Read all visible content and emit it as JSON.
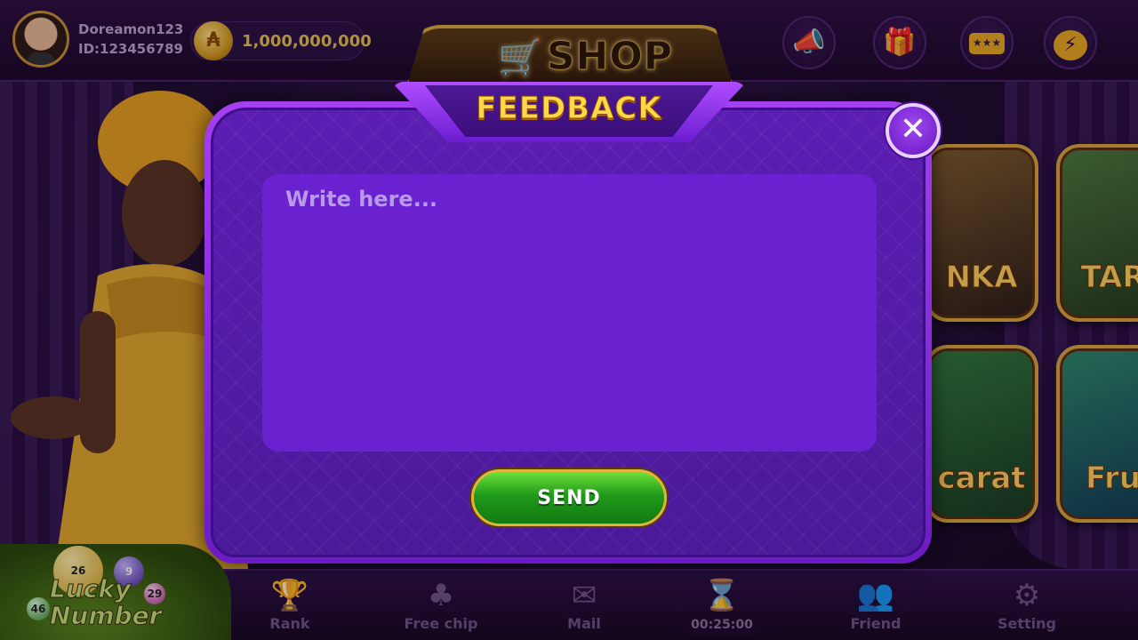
{
  "user": {
    "name": "Doreamon123",
    "id_label": "ID:123456789"
  },
  "wallet": {
    "coin_symbol": "₳",
    "amount": "1,000,000,000"
  },
  "top_bar": {
    "shop_label": "SHOP",
    "icons": [
      "megaphone-icon",
      "gift-icon",
      "ticket-icon",
      "messenger-icon"
    ]
  },
  "games": [
    {
      "title": "NKA"
    },
    {
      "title": "TAR"
    },
    {
      "title": "carat"
    },
    {
      "title": "Fru"
    }
  ],
  "modal": {
    "title": "FEEDBACK",
    "input_placeholder": "Write here...",
    "input_value": "",
    "send_label": "SEND",
    "close_symbol": "✕"
  },
  "bottom_nav": {
    "lucky_number_label": "Lucky Number",
    "lucky_balls": [
      "26",
      "9",
      "46",
      "29"
    ],
    "rank_label": "Rank",
    "free_chip_label": "Free chip",
    "mail_label": "Mail",
    "timer_value": "00:25:00",
    "friend_label": "Friend",
    "setting_label": "Setting"
  },
  "colors": {
    "modal_purple": "#5c1db3",
    "title_gold": "#ffd84a",
    "send_green": "#1f9a1a",
    "nav_muted": "#6e5486"
  }
}
